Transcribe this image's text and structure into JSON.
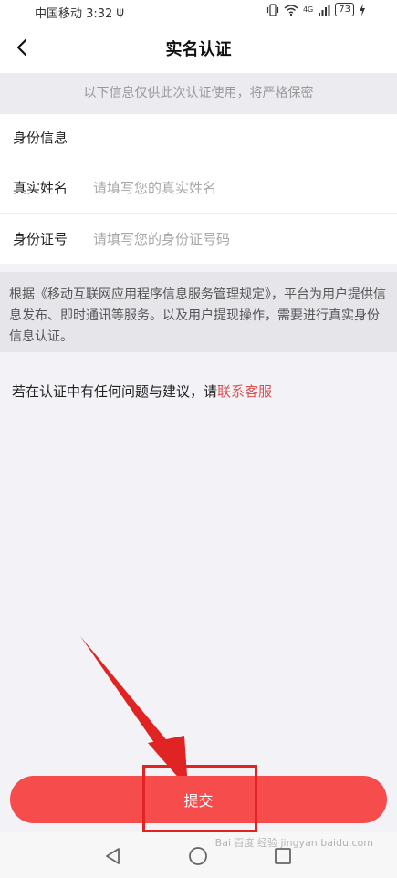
{
  "status_bar": {
    "carrier_time": "中国移动 3:32",
    "usb_glyph": "ψ",
    "network": "4G",
    "battery": "73",
    "icons": [
      "vibrate-icon",
      "wifi-icon",
      "signal-icon",
      "battery-icon",
      "charging-icon"
    ]
  },
  "header": {
    "title": "实名认证",
    "back_icon": "chevron-left-icon"
  },
  "notice": "以下信息仅供此次认证使用，将严格保密",
  "form": {
    "section_title": "身份信息",
    "name_field": {
      "label": "真实姓名",
      "placeholder": "请填写您的真实姓名",
      "value": ""
    },
    "id_field": {
      "label": "身份证号",
      "placeholder": "请填写您的身份证号码",
      "value": ""
    }
  },
  "legal_text": "根据《移动互联网应用程序信息服务管理规定》，平台为用户提供信息发布、即时通讯等服务。以及用户提现操作，需要进行真实身份信息认证。",
  "help": {
    "text": "若在认证中有任何问题与建议，请",
    "link": "联系客服"
  },
  "submit_label": "提交",
  "colors": {
    "accent": "#f64c4c",
    "link": "#e14c4c",
    "annotation": "#e02424"
  },
  "system_nav": [
    "back-triangle-icon",
    "home-circle-icon",
    "recents-square-icon"
  ],
  "watermark": "Bai 百度 经验 jingyan.baidu.com"
}
